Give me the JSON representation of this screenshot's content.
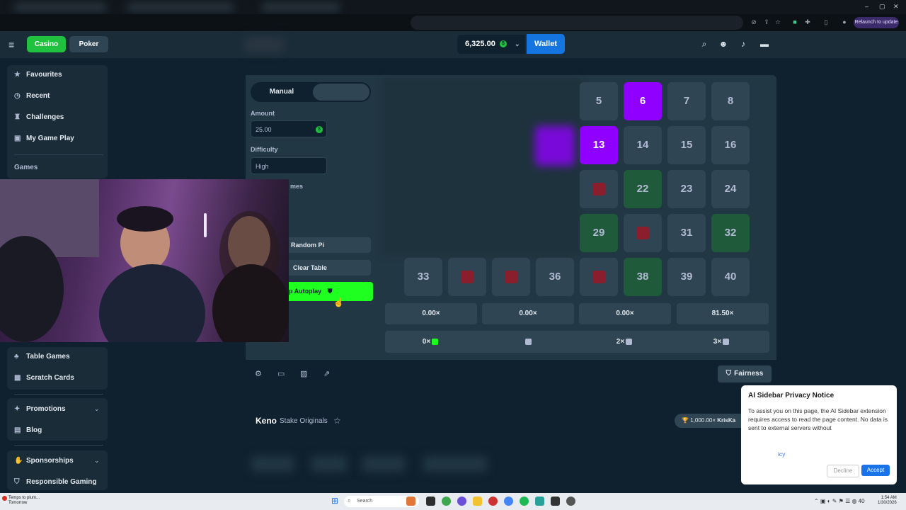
{
  "browser": {
    "relaunch_label": "Relaunch to update",
    "window_controls": [
      "–",
      "▢",
      "✕"
    ]
  },
  "header": {
    "casino_label": "Casino",
    "poker_label": "Poker",
    "balance": "6,325.00",
    "wallet_label": "Wallet"
  },
  "sidebar": {
    "items_top": [
      {
        "label": "Favourites",
        "icon": "star-icon",
        "glyph": "★"
      },
      {
        "label": "Recent",
        "icon": "clock-icon",
        "glyph": "◷"
      },
      {
        "label": "Challenges",
        "icon": "trophy-icon",
        "glyph": "♜"
      },
      {
        "label": "My Game Play",
        "icon": "game-icon",
        "glyph": "▣"
      }
    ],
    "games_header": "Games",
    "items_games": [
      {
        "label": "Table Games",
        "icon": "table-icon",
        "glyph": "♣"
      },
      {
        "label": "Scratch Cards",
        "icon": "grid-icon",
        "glyph": "▦"
      }
    ],
    "items_bottom": [
      {
        "label": "Promotions",
        "icon": "gift-icon",
        "glyph": "✦"
      },
      {
        "label": "Blog",
        "icon": "blog-icon",
        "glyph": "▤"
      }
    ],
    "items_footer": [
      {
        "label": "Sponsorships",
        "icon": "handshake-icon",
        "glyph": "✋"
      },
      {
        "label": "Responsible Gaming",
        "icon": "shield-icon",
        "glyph": "⛉"
      }
    ]
  },
  "controls": {
    "tab_manual": "Manual",
    "amount_label": "Amount",
    "amount_value": "25.00",
    "difficulty_label": "Difficulty",
    "difficulty_value": "High",
    "games_fragment": "mes",
    "random_pick_label": "Random Pi",
    "clear_table_label": "Clear Table",
    "stop_autoplay_label": "p Autoplay"
  },
  "grid": {
    "cells": [
      {
        "n": "5",
        "state": "normal"
      },
      {
        "n": "6",
        "state": "hit"
      },
      {
        "n": "7",
        "state": "normal"
      },
      {
        "n": "8",
        "state": "normal"
      },
      {
        "n": "13",
        "state": "hit"
      },
      {
        "n": "14",
        "state": "normal"
      },
      {
        "n": "15",
        "state": "normal"
      },
      {
        "n": "16",
        "state": "normal"
      },
      {
        "n": "",
        "state": "gem"
      },
      {
        "n": "22",
        "state": "sel"
      },
      {
        "n": "23",
        "state": "normal"
      },
      {
        "n": "24",
        "state": "normal"
      },
      {
        "n": "29",
        "state": "sel"
      },
      {
        "n": "",
        "state": "gem"
      },
      {
        "n": "31",
        "state": "normal"
      },
      {
        "n": "32",
        "state": "sel"
      },
      {
        "n": "33",
        "state": "normal"
      },
      {
        "n": "",
        "state": "gem"
      },
      {
        "n": "",
        "state": "gem"
      },
      {
        "n": "36",
        "state": "normal"
      },
      {
        "n": "",
        "state": "gem"
      },
      {
        "n": "38",
        "state": "sel"
      },
      {
        "n": "39",
        "state": "normal"
      },
      {
        "n": "40",
        "state": "normal"
      }
    ]
  },
  "multipliers": [
    "0.00×",
    "0.00×",
    "0.00×",
    "81.50×"
  ],
  "payouts": [
    {
      "label": "0×",
      "color": "#1fff20"
    },
    {
      "label": "",
      "color": "#b1bad3"
    },
    {
      "label": "2×",
      "color": "#b1bad3"
    },
    {
      "label": "3×",
      "color": "#b1bad3"
    }
  ],
  "bottom_bar": {
    "fairness_label": "Fairness"
  },
  "keno": {
    "title": "Keno",
    "subtitle": "Stake Originals",
    "big_win": "1,000.00×",
    "big_win_user": "KrisKa"
  },
  "notice": {
    "title": "AI Sidebar Privacy Notice",
    "body": "To assist you on this page, the AI Sidebar extension requires access to read the page content. No data is sent to external servers without",
    "link": "icy",
    "decline": "Decline",
    "accept": "Accept"
  },
  "taskbar": {
    "weather_line1": "Temps to plum...",
    "weather_line2": "Tomorrow",
    "search_placeholder": "Search",
    "time": "1:54 AM",
    "date": "1/30/2026"
  },
  "colors": {
    "bg": "#0f212e",
    "panel": "#213743",
    "accent_green": "#1fc13f",
    "hit_purple": "#9000ff",
    "wallet_blue": "#1475e1"
  }
}
